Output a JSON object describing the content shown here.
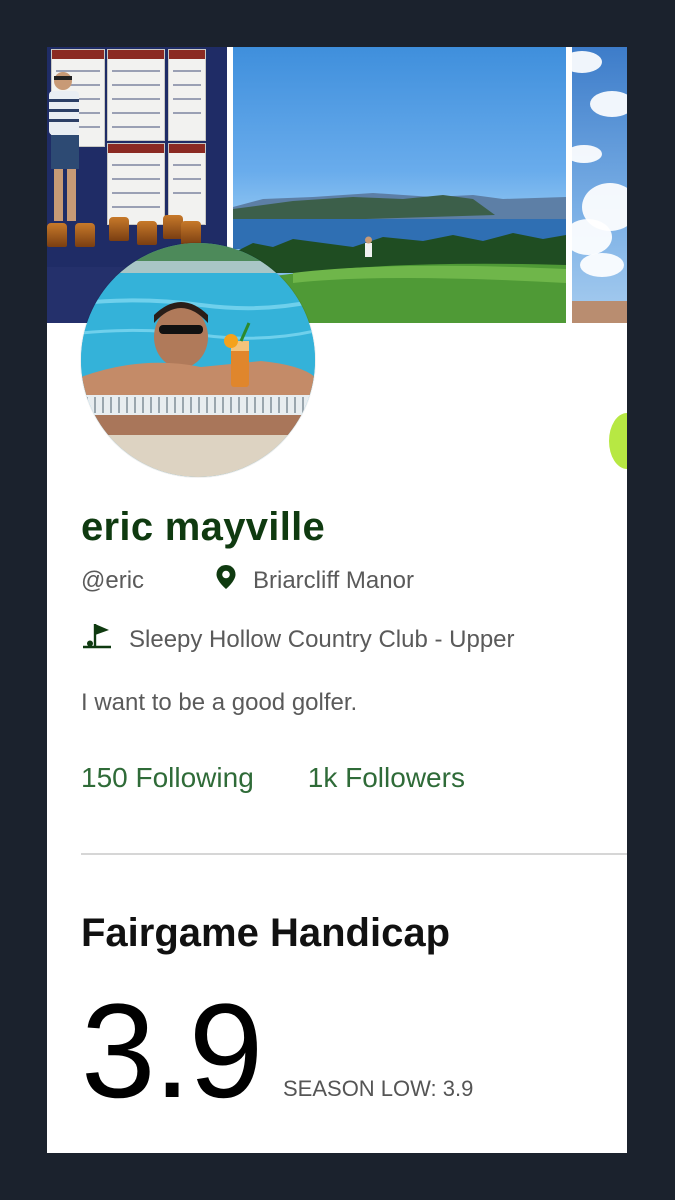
{
  "profile": {
    "name": "eric mayville",
    "handle": "@eric",
    "location": "Briarcliff Manor",
    "club": "Sleepy Hollow Country Club - Upper",
    "bio": "I want to be a good golfer.",
    "following_label": "150 Following",
    "followers_label": "1k Followers"
  },
  "handicap": {
    "title": "Fairgame Handicap",
    "value": "3.9",
    "season_low_label": "SEASON LOW: 3.9"
  },
  "icons": {
    "location": "map-pin-icon",
    "club": "golf-flag-icon"
  },
  "colors": {
    "name": "#0f3a10",
    "icon": "#0f3a10",
    "link": "#2f6b38",
    "accent_tab": "#b7e843",
    "background": "#1b222d"
  }
}
